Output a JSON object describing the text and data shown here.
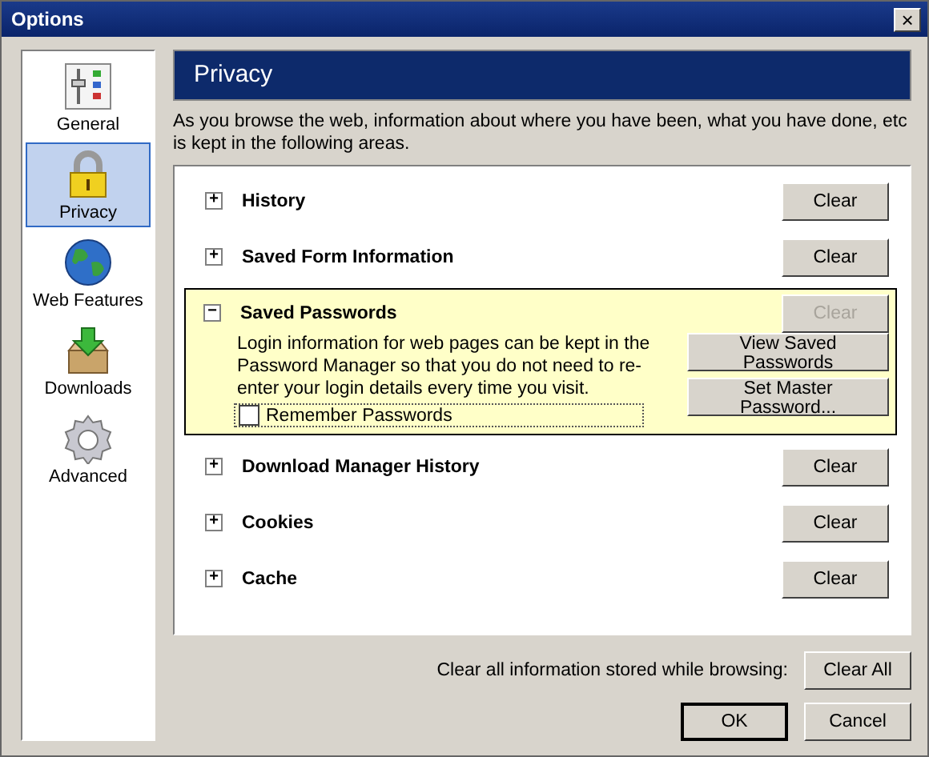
{
  "window": {
    "title": "Options",
    "close": "×"
  },
  "sidebar": {
    "items": [
      {
        "label": "General",
        "selected": false
      },
      {
        "label": "Privacy",
        "selected": true
      },
      {
        "label": "Web Features",
        "selected": false
      },
      {
        "label": "Downloads",
        "selected": false
      },
      {
        "label": "Advanced",
        "selected": false
      }
    ]
  },
  "panel": {
    "title": "Privacy",
    "description": "As you browse the web, information about where you have been, what you have done, etc is kept in the following areas.",
    "sections": [
      {
        "title": "History",
        "expanded": false,
        "expander": "+",
        "clear": {
          "label": "Clear",
          "disabled": false
        }
      },
      {
        "title": "Saved Form Information",
        "expanded": false,
        "expander": "+",
        "clear": {
          "label": "Clear",
          "disabled": false
        }
      },
      {
        "title": "Saved Passwords",
        "expanded": true,
        "expander": "−",
        "clear": {
          "label": "Clear",
          "disabled": true
        },
        "description": "Login information for web pages can be kept in the Password Manager so that you do not need to re-enter your login details every time you visit.",
        "buttons": [
          "View Saved Passwords",
          "Set Master Password..."
        ],
        "checkbox": {
          "label": "Remember Passwords",
          "checked": false
        }
      },
      {
        "title": "Download Manager History",
        "expanded": false,
        "expander": "+",
        "clear": {
          "label": "Clear",
          "disabled": false
        }
      },
      {
        "title": "Cookies",
        "expanded": false,
        "expander": "+",
        "clear": {
          "label": "Clear",
          "disabled": false
        }
      },
      {
        "title": "Cache",
        "expanded": false,
        "expander": "+",
        "clear": {
          "label": "Clear",
          "disabled": false
        }
      }
    ],
    "clear_all_label": "Clear all information stored while browsing:",
    "clear_all_button": "Clear All"
  },
  "buttons": [
    "OK",
    "Cancel"
  ]
}
